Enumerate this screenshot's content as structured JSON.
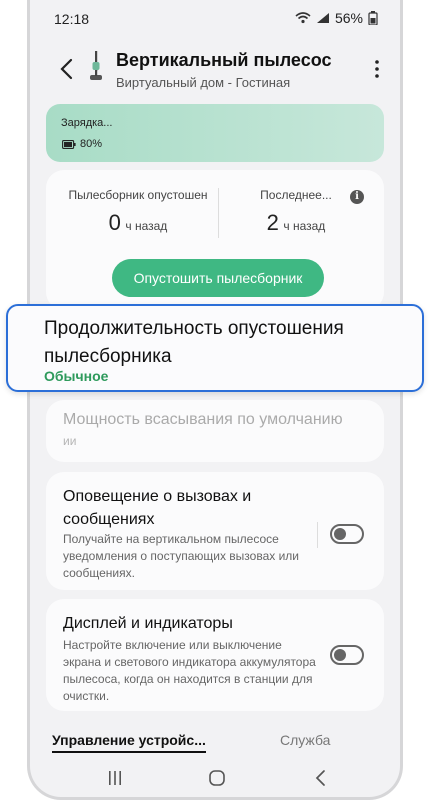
{
  "status_bar": {
    "time": "12:18",
    "battery_percent": "56%"
  },
  "header": {
    "title": "Вертикальный пылесос",
    "subtitle": "Виртуальный дом - Гостиная",
    "back_icon": "chevron-left-icon",
    "more_icon": "more-vertical-icon"
  },
  "battery_card": {
    "status": "Зарядка...",
    "level": "80%"
  },
  "stats": {
    "left_label": "Пылесборник опустошен",
    "left_value": "0",
    "left_unit": "ч назад",
    "right_label": "Последнее...",
    "right_value": "2",
    "right_unit": "ч назад",
    "info_icon": "i"
  },
  "empty_button": {
    "label": "Опустошить пылесборник"
  },
  "highlight": {
    "title": "Продолжительность опустошения пылесборника",
    "value": "Обычное"
  },
  "suction": {
    "title": "Мощность всасывания по умолчанию",
    "value": "ии"
  },
  "call_notifications": {
    "title": "Оповещение о вызовах и сообщениях",
    "description": "Получайте на вертикальном пылесосе уведомления о поступающих вызовах или сообщениях.",
    "enabled": false
  },
  "display_indicators": {
    "title": "Дисплей и индикаторы",
    "description": "Настройте включение или выключение экрана и светового индикатора аккумулятора пылесоса, когда он находится в станции для очистки.",
    "enabled": false
  },
  "tabs": {
    "active": "Управление устройс...",
    "inactive": "Служба"
  },
  "colors": {
    "accent_green": "#3fb883",
    "value_green": "#2e9a5c",
    "highlight_border": "#2c6fd8"
  }
}
